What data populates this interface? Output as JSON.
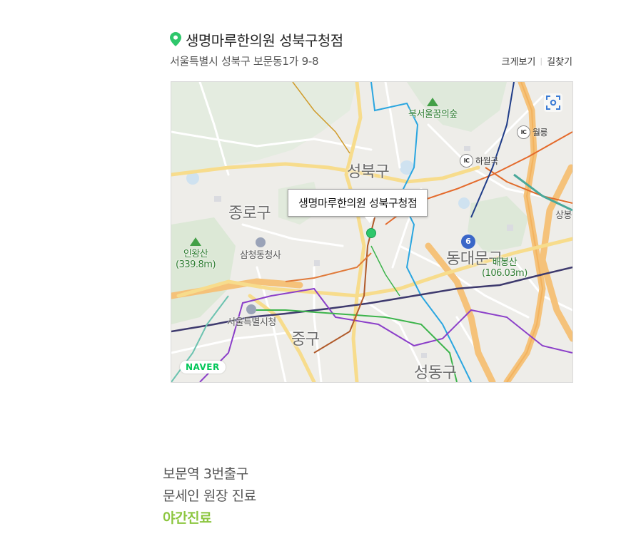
{
  "place": {
    "name": "생명마루한의원 성북구청점",
    "address": "서울특별시 성북구 보문동1가 9-8"
  },
  "map_links": {
    "enlarge": "크게보기",
    "directions": "길찾기"
  },
  "map": {
    "callout": "생명마루한의원 성북구청점",
    "logo": "NAVER",
    "labels": {
      "seongbuk": "성북구",
      "jongno": "종로구",
      "dongdaemun": "동대문구",
      "junggu": "중구",
      "seongdong": "성동구",
      "samcheong": "삼청동청사",
      "cityhall": "서울특별시청",
      "bukseoul_forest": "북서울꿈의숲",
      "inwangsan": "인왕산",
      "inwangsan_height": "(339.8m)",
      "baebongsan": "배봉산",
      "baebongsan_height": "(106.03m)",
      "wolleung": "월릉",
      "hawolgok": "하월곡",
      "sangbong": "상봉",
      "ic_badge": "IC",
      "highway_number": "6"
    }
  },
  "notes": {
    "line1": "보문역 3번출구",
    "line2": "문세인 원장 진료",
    "highlight": "야간진료"
  },
  "colors": {
    "marker": "#2ec76b",
    "pin": "#2ec76b",
    "naver_green": "#03c75a",
    "highlight_text": "#8cc63f",
    "arterial_road": "#f5c27a"
  }
}
